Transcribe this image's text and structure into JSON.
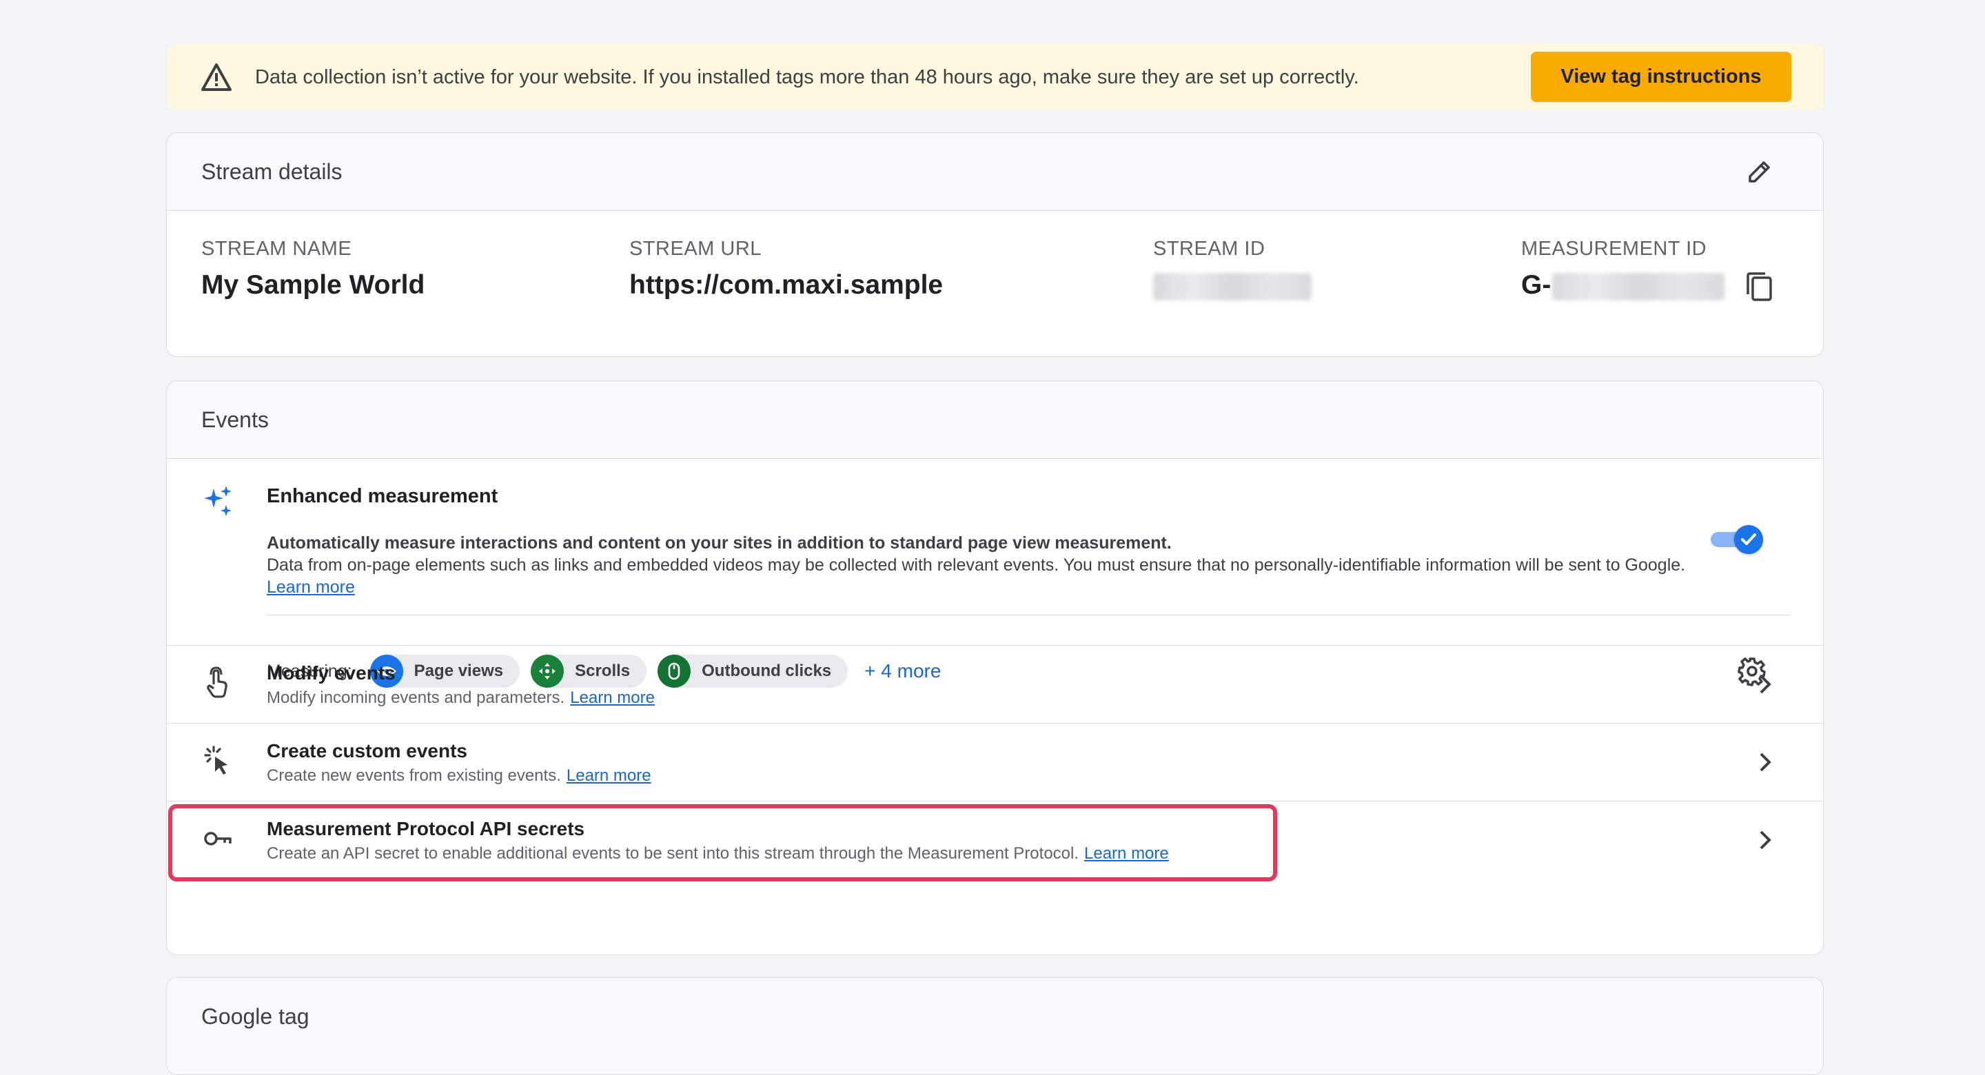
{
  "banner": {
    "message": "Data collection isn’t active for your website. If you installed tags more than 48 hours ago, make sure they are set up correctly.",
    "button_label": "View tag instructions"
  },
  "stream_details": {
    "title": "Stream details",
    "fields": [
      {
        "label": "STREAM NAME",
        "value": "My Sample World"
      },
      {
        "label": "STREAM URL",
        "value": "https://com.maxi.sample"
      },
      {
        "label": "STREAM ID",
        "value": ""
      },
      {
        "label": "MEASUREMENT ID",
        "value": "G-"
      }
    ]
  },
  "events": {
    "title": "Events",
    "enhanced": {
      "title": "Enhanced measurement",
      "desc1": "Automatically measure interactions and content on your sites in addition to standard page view measurement.",
      "desc2": "Data from on-page elements such as links and embedded videos may be collected with relevant events. You must ensure that no personally-identifiable information will be sent to Google.",
      "learn_more": "Learn more",
      "toggle_on": true,
      "measuring_label": "Measuring:",
      "chips": [
        {
          "label": "Page views",
          "icon": "eye-icon",
          "color": "#1a73e8"
        },
        {
          "label": "Scrolls",
          "icon": "scroll-arrows-icon",
          "color": "#188038"
        },
        {
          "label": "Outbound clicks",
          "icon": "mouse-icon",
          "color": "#137333"
        }
      ],
      "more_label": "+ 4 more"
    },
    "rows": [
      {
        "title": "Modify events",
        "desc": "Modify incoming events and parameters.",
        "link": "Learn more",
        "icon": "touch-hand-icon"
      },
      {
        "title": "Create custom events",
        "desc": "Create new events from existing events.",
        "link": "Learn more",
        "icon": "click-cursor-icon"
      },
      {
        "title": "Measurement Protocol API secrets",
        "desc": "Create an API secret to enable additional events to be sent into this stream through the Measurement Protocol.",
        "link": "Learn more",
        "icon": "key-icon",
        "highlighted": true
      }
    ]
  },
  "google_tag": {
    "title": "Google tag"
  },
  "colors": {
    "accent": "#1a73e8",
    "warning_bg": "#fef7e0",
    "button": "#f9ab00",
    "highlight": "#e8375f"
  }
}
